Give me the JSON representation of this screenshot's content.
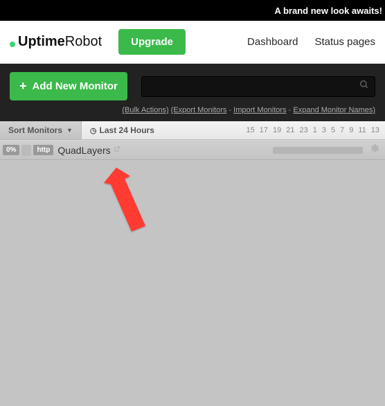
{
  "banner": {
    "text": "A brand new look awaits! "
  },
  "logo": {
    "part1": "Uptime",
    "part2": "Robot"
  },
  "upgrade_label": "Upgrade",
  "nav": {
    "dashboard": "Dashboard",
    "status": "Status pages"
  },
  "add_monitor_label": "Add New Monitor",
  "toolbar_links": {
    "bulk": "(Bulk Actions)",
    "export": "(Export Monitors",
    "sep1": " - ",
    "import": "Import Monitors",
    "sep2": " - ",
    "expand": "Expand Monitor Names)"
  },
  "sort_label": "Sort Monitors",
  "time_label": "Last 24 Hours",
  "hours": [
    "15",
    "17",
    "19",
    "21",
    "23",
    "1",
    "3",
    "5",
    "7",
    "9",
    "11",
    "13"
  ],
  "monitor": {
    "pct": "0%",
    "type": "http",
    "name": "QuadLayers"
  }
}
